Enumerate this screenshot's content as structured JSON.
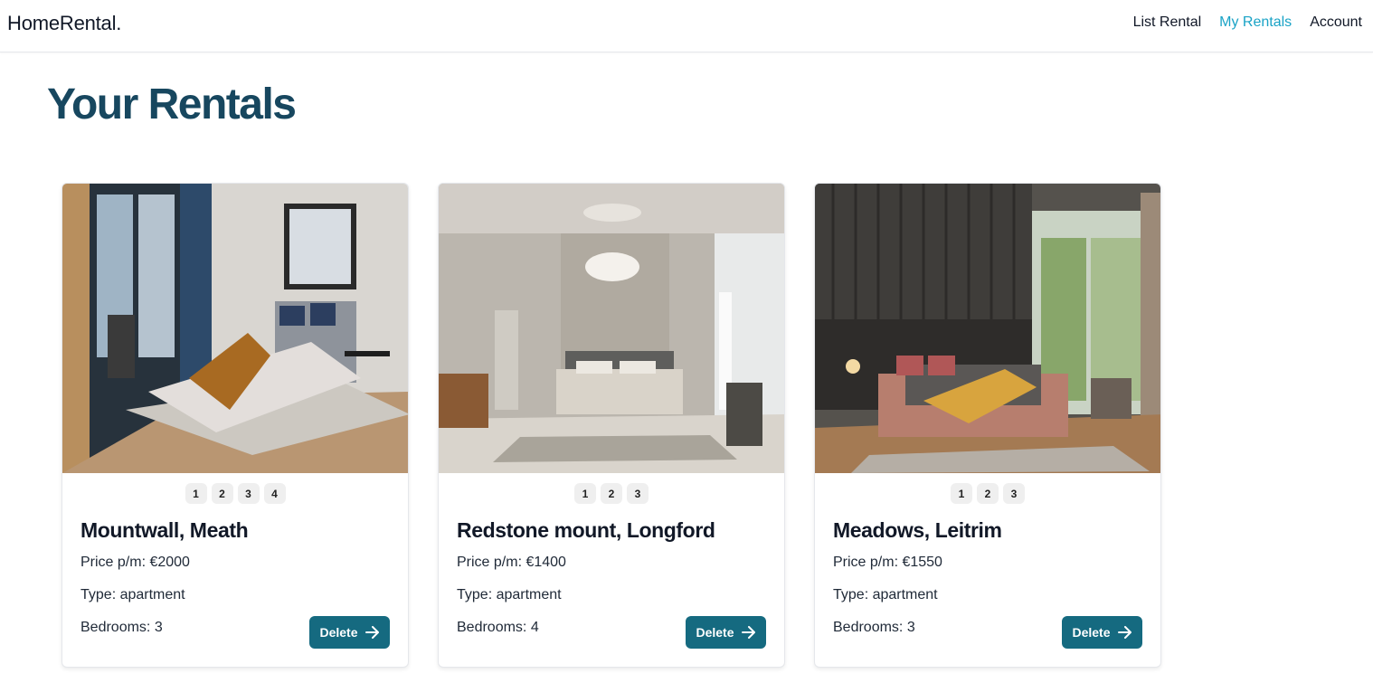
{
  "brand": "HomeRental.",
  "nav": {
    "items": [
      {
        "label": "List Rental",
        "active": false
      },
      {
        "label": "My Rentals",
        "active": true
      },
      {
        "label": "Account",
        "active": false
      }
    ]
  },
  "page": {
    "title": "Your Rentals"
  },
  "colors": {
    "accent": "#1aa3c6",
    "title": "#17475f",
    "button": "#156a80"
  },
  "rentals": [
    {
      "title": "Mountwall, Meath",
      "image_icon": "bedroom-photo",
      "pages": [
        "1",
        "2",
        "3",
        "4"
      ],
      "price": "Price p/m: €2000",
      "type": "Type: apartment",
      "bedrooms": "Bedrooms: 3",
      "delete_label": "Delete"
    },
    {
      "title": "Redstone mount, Longford",
      "image_icon": "bedroom-photo",
      "pages": [
        "1",
        "2",
        "3"
      ],
      "price": "Price p/m: €1400",
      "type": "Type: apartment",
      "bedrooms": "Bedrooms: 4",
      "delete_label": "Delete"
    },
    {
      "title": "Meadows, Leitrim",
      "image_icon": "bedroom-photo",
      "pages": [
        "1",
        "2",
        "3"
      ],
      "price": "Price p/m: €1550",
      "type": "Type: apartment",
      "bedrooms": "Bedrooms: 3",
      "delete_label": "Delete"
    }
  ]
}
